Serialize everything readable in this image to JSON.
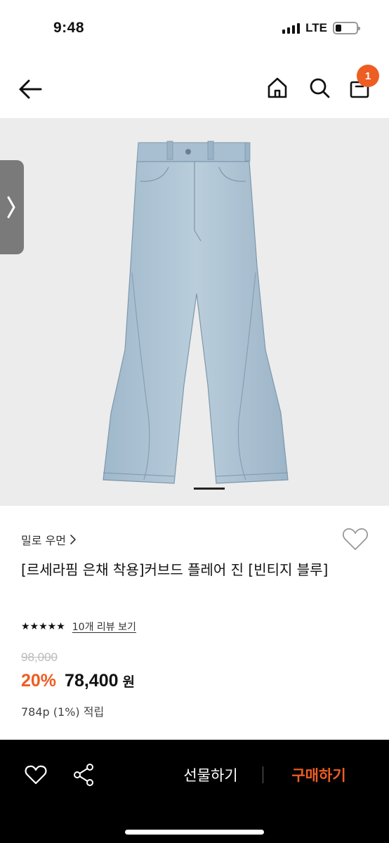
{
  "status_bar": {
    "time": "9:48",
    "network": "LTE"
  },
  "nav": {
    "cart_count": "1"
  },
  "product": {
    "brand": "밀로 우먼",
    "title": "[르세라핌 은채 착용]커브드 플레어 진 [빈티지 블루]",
    "rating_stars": "★★★★★",
    "review_link": "10개 리뷰 보기",
    "original_price": "98,000",
    "discount": "20%",
    "price": "78,400",
    "currency": "원",
    "points": "784p (1%) 적립"
  },
  "bottom_bar": {
    "gift_label": "선물하기",
    "buy_label": "구매하기"
  },
  "colors": {
    "accent": "#ee5d22",
    "bottom_bar_bg": "#000000",
    "image_bg": "#ececec",
    "denim": "#a9c0d3"
  },
  "icons": [
    "back-arrow-icon",
    "home-icon",
    "search-icon",
    "shopping-bag-icon",
    "chevron-right-icon",
    "heart-icon",
    "share-icon"
  ]
}
